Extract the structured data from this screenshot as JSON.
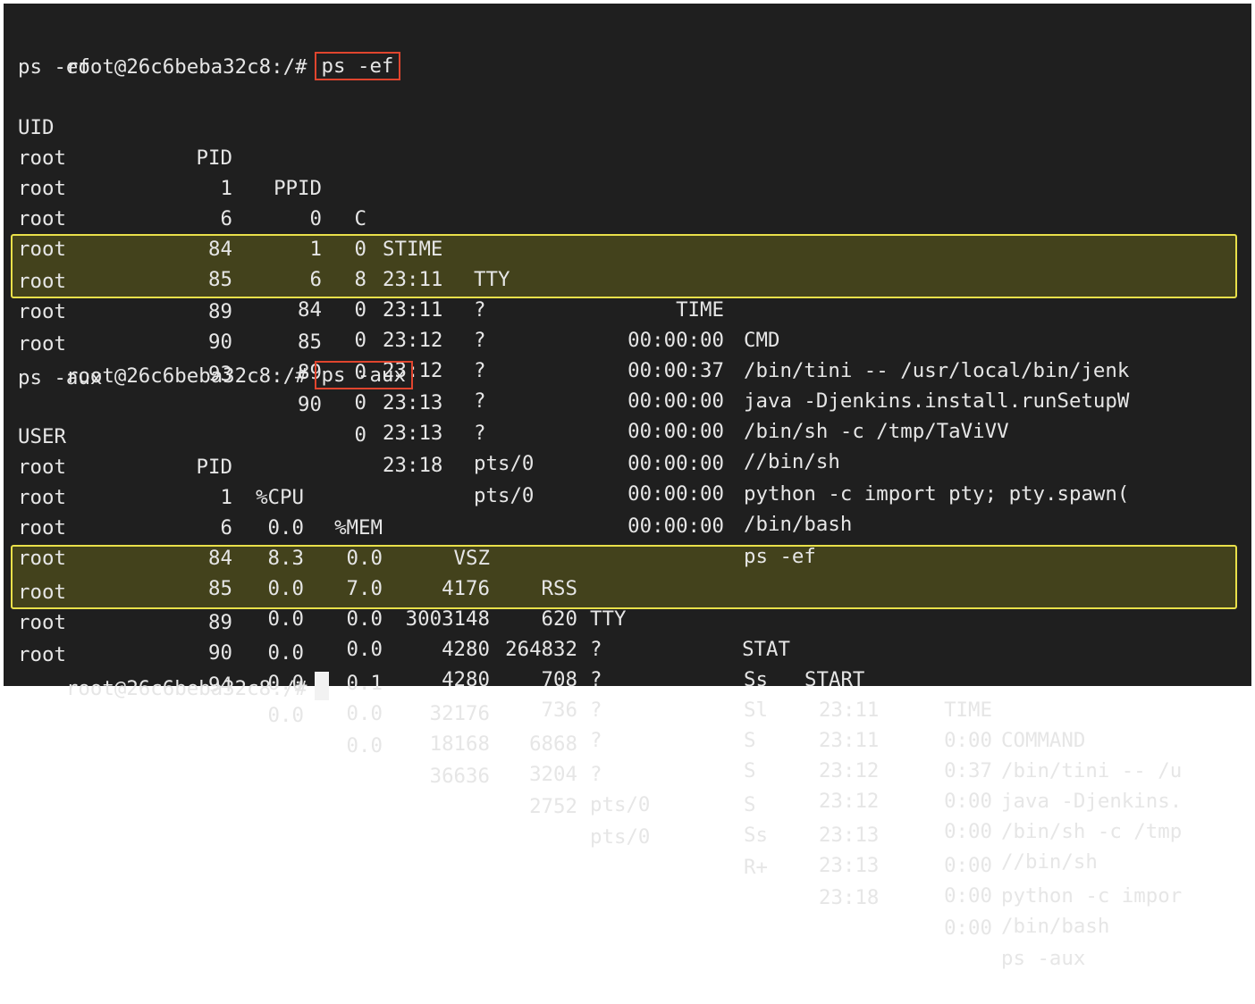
{
  "prompt": "root@26c6beba32c8:/#",
  "ef": {
    "command": "ps -ef",
    "echo": "ps -ef",
    "headers": {
      "uid": "UID",
      "pid": "PID",
      "ppid": "PPID",
      "c": "C",
      "stime": "STIME",
      "tty": "TTY",
      "time": "TIME",
      "cmd": "CMD"
    },
    "rows": [
      {
        "uid": "root",
        "pid": "1",
        "ppid": "0",
        "c": "0",
        "stime": "23:11",
        "tty": "?",
        "time": "00:00:00",
        "cmd": "/bin/tini -- /usr/local/bin/jenk"
      },
      {
        "uid": "root",
        "pid": "6",
        "ppid": "1",
        "c": "8",
        "stime": "23:11",
        "tty": "?",
        "time": "00:00:37",
        "cmd": "java -Djenkins.install.runSetupW"
      },
      {
        "uid": "root",
        "pid": "84",
        "ppid": "6",
        "c": "0",
        "stime": "23:12",
        "tty": "?",
        "time": "00:00:00",
        "cmd": "/bin/sh -c /tmp/TaViVV"
      },
      {
        "uid": "root",
        "pid": "85",
        "ppid": "84",
        "c": "0",
        "stime": "23:12",
        "tty": "?",
        "time": "00:00:00",
        "cmd": "//bin/sh"
      },
      {
        "uid": "root",
        "pid": "89",
        "ppid": "85",
        "c": "0",
        "stime": "23:13",
        "tty": "?",
        "time": "00:00:00",
        "cmd": "python -c import pty; pty.spawn("
      },
      {
        "uid": "root",
        "pid": "90",
        "ppid": "89",
        "c": "0",
        "stime": "23:13",
        "tty": "pts/0",
        "time": "00:00:00",
        "cmd": "/bin/bash"
      },
      {
        "uid": "root",
        "pid": "93",
        "ppid": "90",
        "c": "0",
        "stime": "23:18",
        "tty": "pts/0",
        "time": "00:00:00",
        "cmd": "ps -ef"
      }
    ]
  },
  "aux": {
    "command": "ps -aux",
    "echo": "ps -aux",
    "headers": {
      "user": "USER",
      "pid": "PID",
      "cpu": "%CPU",
      "mem": "%MEM",
      "vsz": "VSZ",
      "rss": "RSS",
      "tty": "TTY",
      "stat": "STAT",
      "start": "START",
      "time": "TIME",
      "command": "COMMAND"
    },
    "rows": [
      {
        "user": "root",
        "pid": "1",
        "cpu": "0.0",
        "mem": "0.0",
        "vsz": "4176",
        "rss": "620",
        "tty": "?",
        "stat": "Ss",
        "start": "23:11",
        "time": "0:00",
        "command": "/bin/tini -- /u"
      },
      {
        "user": "root",
        "pid": "6",
        "cpu": "8.3",
        "mem": "7.0",
        "vsz": "3003148",
        "rss": "264832",
        "tty": "?",
        "stat": "Sl",
        "start": "23:11",
        "time": "0:37",
        "command": "java -Djenkins."
      },
      {
        "user": "root",
        "pid": "84",
        "cpu": "0.0",
        "mem": "0.0",
        "vsz": "4280",
        "rss": "708",
        "tty": "?",
        "stat": "S",
        "start": "23:12",
        "time": "0:00",
        "command": "/bin/sh -c /tmp"
      },
      {
        "user": "root",
        "pid": "85",
        "cpu": "0.0",
        "mem": "0.0",
        "vsz": "4280",
        "rss": "736",
        "tty": "?",
        "stat": "S",
        "start": "23:12",
        "time": "0:00",
        "command": "//bin/sh"
      },
      {
        "user": "root",
        "pid": "89",
        "cpu": "0.0",
        "mem": "0.1",
        "vsz": "32176",
        "rss": "6868",
        "tty": "?",
        "stat": "S",
        "start": "23:13",
        "time": "0:00",
        "command": "python -c impor"
      },
      {
        "user": "root",
        "pid": "90",
        "cpu": "0.0",
        "mem": "0.0",
        "vsz": "18168",
        "rss": "3204",
        "tty": "pts/0",
        "stat": "Ss",
        "start": "23:13",
        "time": "0:00",
        "command": "/bin/bash"
      },
      {
        "user": "root",
        "pid": "94",
        "cpu": "0.0",
        "mem": "0.0",
        "vsz": "36636",
        "rss": "2752",
        "tty": "pts/0",
        "stat": "R+",
        "start": "23:18",
        "time": "0:00",
        "command": "ps -aux"
      }
    ]
  },
  "colors": {
    "background": "#1f1f1f",
    "text": "#e6e6e6",
    "command_box": "#e0452e",
    "highlight_box": "#e9e04a"
  }
}
